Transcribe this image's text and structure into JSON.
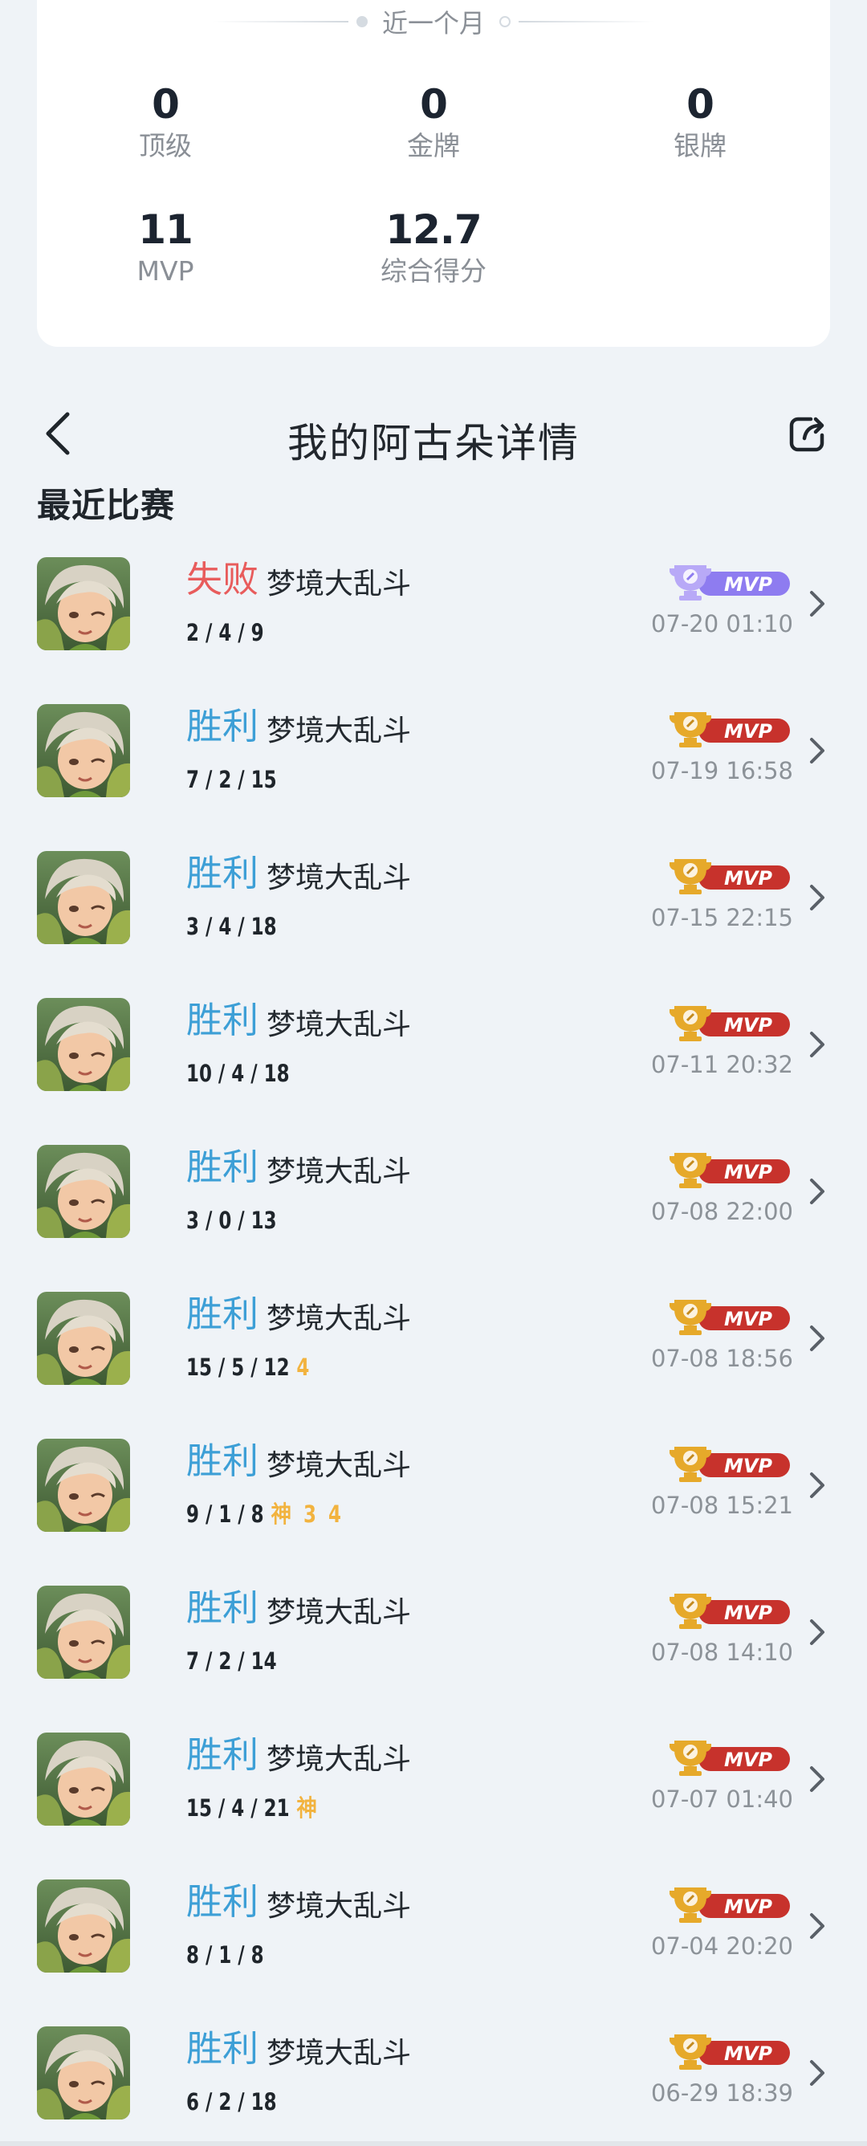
{
  "stats": {
    "period": "近一个月",
    "items": [
      {
        "value": "0",
        "label": "顶级"
      },
      {
        "value": "0",
        "label": "金牌"
      },
      {
        "value": "0",
        "label": "银牌"
      },
      {
        "value": "11",
        "label": "MVP"
      },
      {
        "value": "12.7",
        "label": "综合得分"
      }
    ]
  },
  "header": {
    "title": "我的阿古朵详情"
  },
  "section_title": "最近比赛",
  "colors": {
    "win": "#3d9fd6",
    "lose": "#e85c5c",
    "mvp_gold": "#c7322c",
    "mvp_purple": "#8e7cf0",
    "tag": "#f2b33f"
  },
  "matches": [
    {
      "result": "失败",
      "outcome": "lose",
      "mode": "梦境大乱斗",
      "kda": "2 / 4 / 9",
      "tags": "",
      "badge": "MVP",
      "badge_style": "purple",
      "time": "07-20 01:10"
    },
    {
      "result": "胜利",
      "outcome": "win",
      "mode": "梦境大乱斗",
      "kda": "7 / 2 / 15",
      "tags": "",
      "badge": "MVP",
      "badge_style": "gold",
      "time": "07-19 16:58"
    },
    {
      "result": "胜利",
      "outcome": "win",
      "mode": "梦境大乱斗",
      "kda": "3 / 4 / 18",
      "tags": "",
      "badge": "MVP",
      "badge_style": "gold",
      "time": "07-15 22:15"
    },
    {
      "result": "胜利",
      "outcome": "win",
      "mode": "梦境大乱斗",
      "kda": "10 / 4 / 18",
      "tags": "",
      "badge": "MVP",
      "badge_style": "gold",
      "time": "07-11 20:32"
    },
    {
      "result": "胜利",
      "outcome": "win",
      "mode": "梦境大乱斗",
      "kda": "3 / 0 / 13",
      "tags": "",
      "badge": "MVP",
      "badge_style": "gold",
      "time": "07-08 22:00"
    },
    {
      "result": "胜利",
      "outcome": "win",
      "mode": "梦境大乱斗",
      "kda": "15 / 5 / 12",
      "tags": "4",
      "badge": "MVP",
      "badge_style": "gold",
      "time": "07-08 18:56"
    },
    {
      "result": "胜利",
      "outcome": "win",
      "mode": "梦境大乱斗",
      "kda": "9 / 1 / 8",
      "tags": "神 3 4",
      "badge": "MVP",
      "badge_style": "gold",
      "time": "07-08 15:21"
    },
    {
      "result": "胜利",
      "outcome": "win",
      "mode": "梦境大乱斗",
      "kda": "7 / 2 / 14",
      "tags": "",
      "badge": "MVP",
      "badge_style": "gold",
      "time": "07-08 14:10"
    },
    {
      "result": "胜利",
      "outcome": "win",
      "mode": "梦境大乱斗",
      "kda": "15 / 4 / 21",
      "tags": "神",
      "badge": "MVP",
      "badge_style": "gold",
      "time": "07-07 01:40"
    },
    {
      "result": "胜利",
      "outcome": "win",
      "mode": "梦境大乱斗",
      "kda": "8 / 1 / 8",
      "tags": "",
      "badge": "MVP",
      "badge_style": "gold",
      "time": "07-04 20:20"
    },
    {
      "result": "胜利",
      "outcome": "win",
      "mode": "梦境大乱斗",
      "kda": "6 / 2 / 18",
      "tags": "",
      "badge": "MVP",
      "badge_style": "gold",
      "time": "06-29 18:39"
    }
  ]
}
